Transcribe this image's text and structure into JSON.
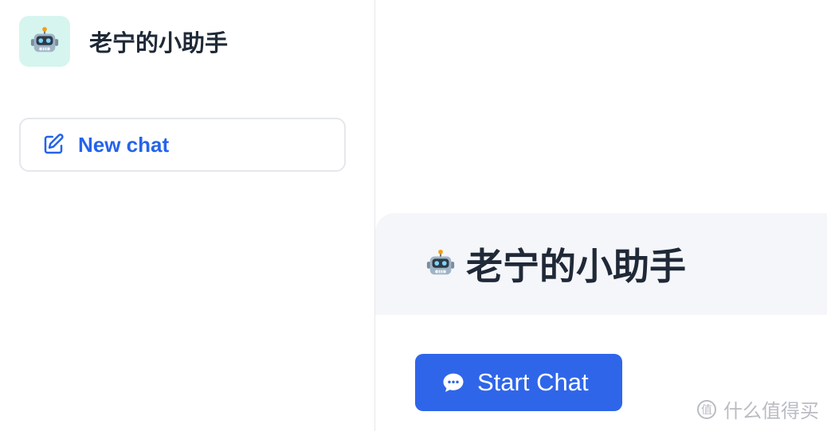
{
  "app": {
    "brand_name": "老宁的小助手",
    "logo_icon": "robot-icon"
  },
  "sidebar": {
    "new_chat_label": "New chat",
    "new_chat_icon": "edit-icon"
  },
  "main": {
    "hero_title": "老宁的小助手",
    "hero_icon": "robot-icon",
    "start_chat_label": "Start Chat",
    "start_chat_icon": "chat-bubble-icon"
  },
  "watermark": {
    "text": "什么值得买",
    "icon": "smzdm-logo-icon"
  },
  "colors": {
    "accent": "#2f66e9",
    "link": "#2563eb",
    "logo_bg": "#d6f5ee",
    "hero_bg": "#f5f6fa",
    "title_text": "#1f2937",
    "border": "#e5e7eb"
  }
}
